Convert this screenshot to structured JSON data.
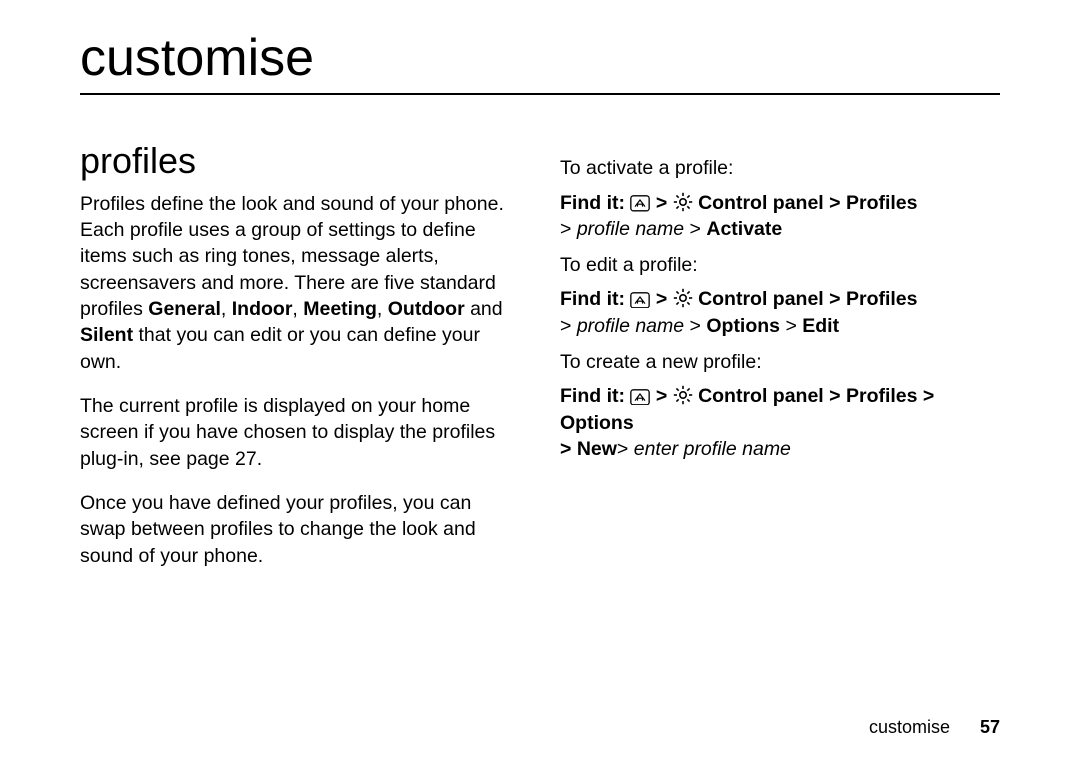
{
  "chapter": "customise",
  "section": "profiles",
  "left": {
    "p1a": "Profiles define the look and sound of your phone. Each profile uses a group of settings to define items such as ring tones, message alerts, screensavers and more. There are five standard profiles ",
    "p1b_general": "General",
    "p1b_sep1": ", ",
    "p1b_indoor": "Indoor",
    "p1b_sep2": ", ",
    "p1b_meeting": "Meeting",
    "p1b_sep3": ", ",
    "p1b_outdoor": "Outdoor",
    "p1c": " and ",
    "p1b_silent": "Silent",
    "p1d": " that you can edit or you can define your own.",
    "p2": "The current profile is displayed on your home screen if you have chosen to display the profiles plug-in, see page 27.",
    "p3": "Once you have defined your profiles, you can swap between profiles to change the look and sound of your phone."
  },
  "right": {
    "activate_intro": "To activate a profile:",
    "find_it": "Find it:",
    "sep": " > ",
    "control_panel": "Control panel",
    "profiles": "Profiles",
    "profile_name": "profile name",
    "options": "Options",
    "activate": "Activate",
    "edit_intro": "To edit a profile:",
    "edit": "Edit",
    "create_intro": "To create a new profile:",
    "new": "New",
    "enter_profile_name": "enter profile name",
    "gt_close": "> "
  },
  "footer": {
    "label": "customise",
    "page": "57"
  },
  "icons": {
    "home": "home-icon",
    "settings": "settings-icon"
  }
}
